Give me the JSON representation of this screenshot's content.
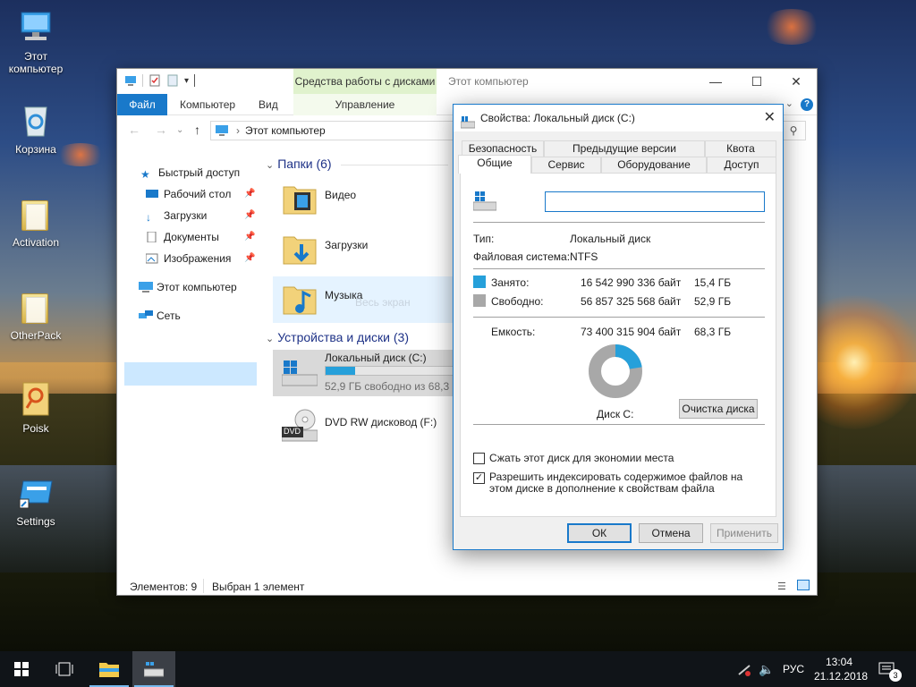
{
  "desktop": {
    "icons": [
      {
        "label": "Этот компьютер",
        "icon": "computer-icon"
      },
      {
        "label": "Корзина",
        "icon": "recycle-bin-icon"
      },
      {
        "label": "Activation",
        "icon": "folder-icon"
      },
      {
        "label": "OtherPack",
        "icon": "folder-icon"
      },
      {
        "label": "Poisk",
        "icon": "search-app-icon"
      },
      {
        "label": "Settings",
        "icon": "settings-shortcut-icon"
      }
    ]
  },
  "explorer": {
    "title": "Этот компьютер",
    "tools_header": "Средства работы с дисками",
    "ribbon": {
      "file": "Файл",
      "computer": "Компьютер",
      "view": "Вид",
      "manage": "Управление"
    },
    "address": "Этот компьютер",
    "nav": {
      "quick_access": "Быстрый доступ",
      "desktop": "Рабочий стол",
      "downloads": "Загрузки",
      "documents": "Документы",
      "pictures": "Изображения",
      "this_pc": "Этот компьютер",
      "network": "Сеть"
    },
    "folders_header": "Папки (6)",
    "folders": {
      "video": "Видео",
      "downloads": "Загрузки",
      "music": "Музыка",
      "music_ghost": "Весь экран"
    },
    "devices_header": "Устройства и диски (3)",
    "drives": {
      "c_label": "Локальный диск (C:)",
      "c_free": "52,9 ГБ свободно из 68,3 ГБ",
      "c_used_fraction": 0.226,
      "dvd_label": "DVD RW дисковод (F:)",
      "dvd_badge": "DVD"
    },
    "status": {
      "items": "Элементов: 9",
      "selected": "Выбран 1 элемент"
    }
  },
  "dialog": {
    "title": "Свойства: Локальный диск (C:)",
    "tabs_row1": [
      "Безопасность",
      "Предыдущие версии",
      "Квота"
    ],
    "tabs_row2": [
      "Общие",
      "Сервис",
      "Оборудование",
      "Доступ"
    ],
    "name_value": "",
    "type_label": "Тип:",
    "type_value": "Локальный диск",
    "fs_label": "Файловая система:",
    "fs_value": "NTFS",
    "used_label": "Занято:",
    "used_bytes": "16 542 990 336 байт",
    "used_gb": "15,4 ГБ",
    "free_label": "Свободно:",
    "free_bytes": "56 857 325 568 байт",
    "free_gb": "52,9 ГБ",
    "capacity_label": "Емкость:",
    "capacity_bytes": "73 400 315 904 байт",
    "capacity_gb": "68,3 ГБ",
    "disk_label": "Диск C:",
    "cleanup_button": "Очистка диска",
    "compress_label": "Сжать этот диск для экономии места",
    "compress_checked": false,
    "index_label": "Разрешить индексировать содержимое файлов на этом диске в дополнение к свойствам файла",
    "index_checked": true,
    "ok": "ОК",
    "cancel": "Отмена",
    "apply": "Применить",
    "used_fraction": 0.225,
    "colors": {
      "used": "#26a0da",
      "free": "#a8a8a8"
    }
  },
  "taskbar": {
    "lang": "РУС",
    "time": "13:04",
    "date": "21.12.2018",
    "notifications": "3"
  }
}
